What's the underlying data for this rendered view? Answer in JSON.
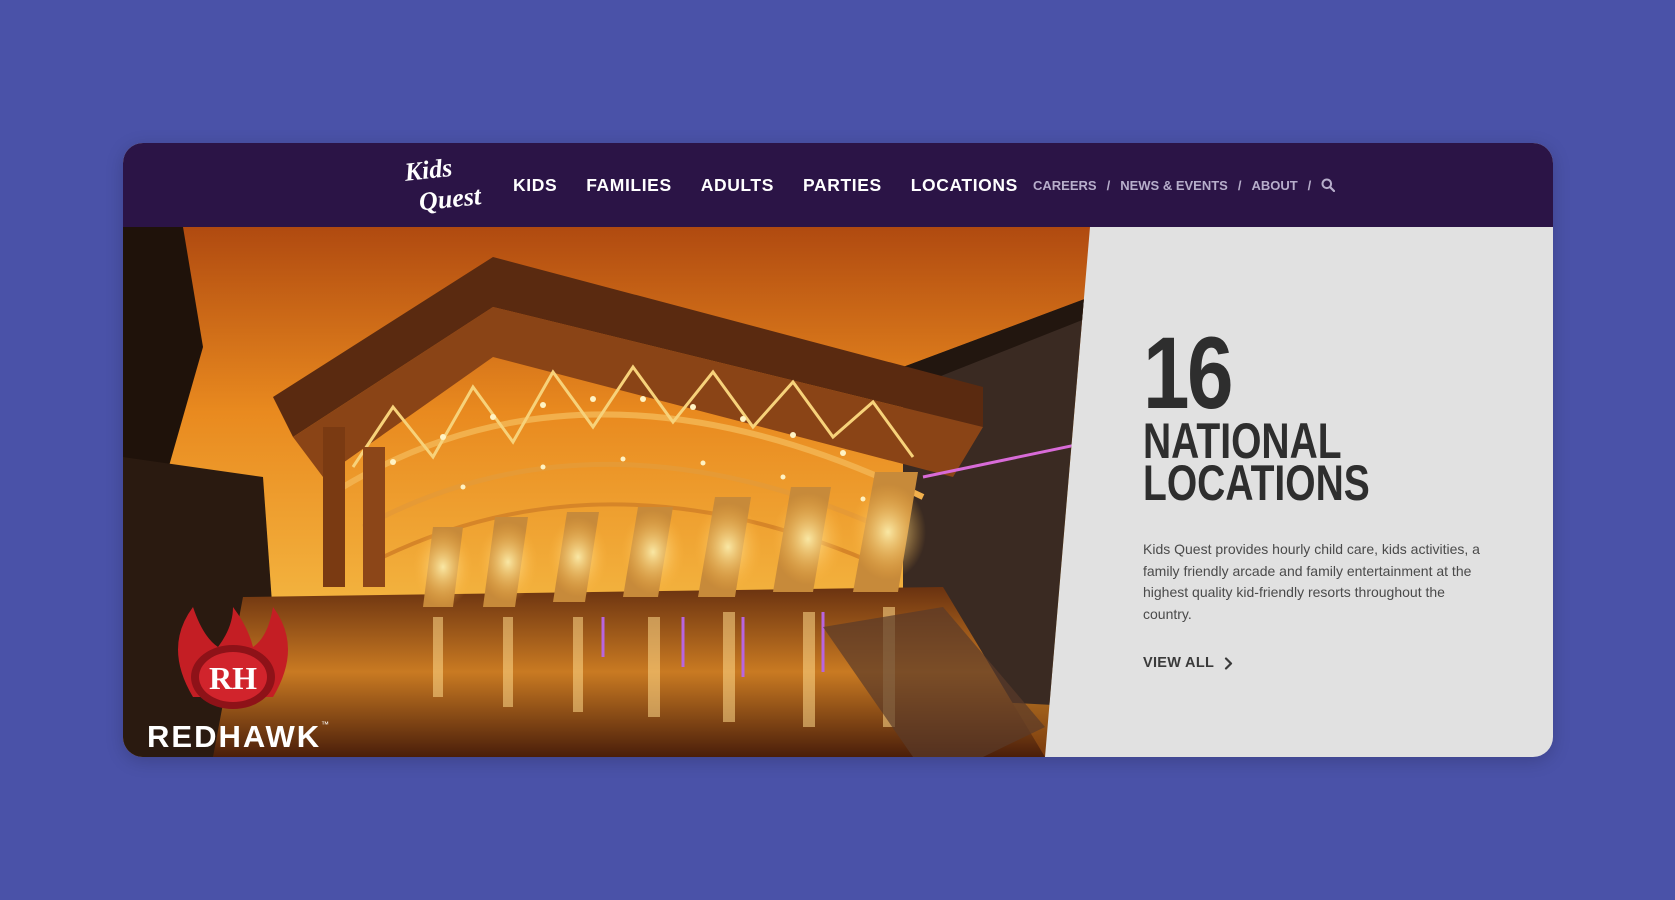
{
  "brand": {
    "logo_line1": "Kids",
    "logo_line2": "Quest"
  },
  "main_nav": [
    {
      "label": "KIDS"
    },
    {
      "label": "FAMILIES"
    },
    {
      "label": "ADULTS"
    },
    {
      "label": "PARTIES"
    },
    {
      "label": "LOCATIONS"
    }
  ],
  "util_nav": [
    {
      "label": "CAREERS"
    },
    {
      "label": "NEWS & EVENTS"
    },
    {
      "label": "ABOUT"
    }
  ],
  "hero": {
    "venue_name": "REDHAWK",
    "venue_trademark": "™",
    "venue_monogram": "RH",
    "count": "16",
    "headline_line1": "NATIONAL",
    "headline_line2": "LOCATIONS",
    "description": "Kids Quest provides hourly child care, kids activities, a family friendly arcade and family entertainment at the highest quality kid-friendly resorts throughout the country.",
    "cta_label": "VIEW ALL"
  },
  "colors": {
    "page_background": "#4a52a8",
    "nav_background": "#2b1446",
    "panel_background": "#e1e1e1",
    "heading_text": "#2e2e2e"
  },
  "icons": {
    "search": "search-icon",
    "cta_arrow": "chevron-right-icon"
  }
}
